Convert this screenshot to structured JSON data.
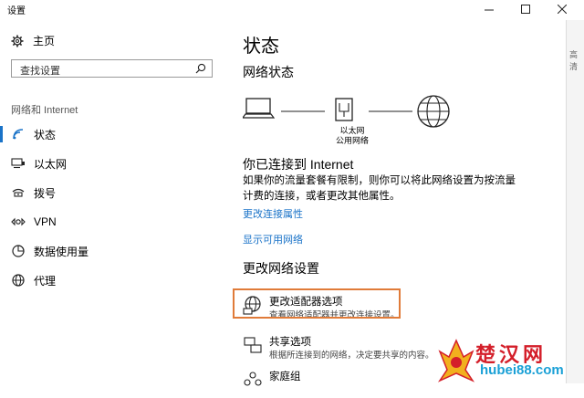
{
  "window": {
    "title": "设置"
  },
  "sidebar": {
    "home_label": "主页",
    "search_placeholder": "查找设置",
    "section_title": "网络和 Internet",
    "items": [
      {
        "label": "状态",
        "icon": "status-icon",
        "active": true
      },
      {
        "label": "以太网",
        "icon": "ethernet-icon",
        "active": false
      },
      {
        "label": "拨号",
        "icon": "dialup-icon",
        "active": false
      },
      {
        "label": "VPN",
        "icon": "vpn-icon",
        "active": false
      },
      {
        "label": "数据使用量",
        "icon": "data-usage-icon",
        "active": false
      },
      {
        "label": "代理",
        "icon": "proxy-icon",
        "active": false
      }
    ]
  },
  "main": {
    "title": "状态",
    "network_status_heading": "网络状态",
    "adapter_caption_1": "以太网",
    "adapter_caption_2": "公用网络",
    "connected_heading": "你已连接到 Internet",
    "connected_desc": "如果你的流量套餐有限制，则你可以将此网络设置为按流量计费的连接，或者更改其他属性。",
    "link_change_props": "更改连接属性",
    "link_show_networks": "显示可用网络",
    "change_settings_heading": "更改网络设置",
    "options": [
      {
        "title": "更改适配器选项",
        "subtitle": "查看网络适配器并更改连接设置。",
        "icon": "adapter-icon"
      },
      {
        "title": "共享选项",
        "subtitle": "根据所连接到的网络，决定要共享的内容。",
        "icon": "sharing-icon"
      },
      {
        "title": "家庭组",
        "subtitle": "",
        "icon": "homegroup-icon"
      }
    ]
  },
  "edge_text": "高清",
  "watermark": {
    "brand": "楚汉网",
    "url": "hubei88.com"
  },
  "colors": {
    "accent": "#1a73c8",
    "highlight": "#e07b39",
    "watermark_red": "#d41f2a",
    "watermark_blue": "#1aa0d6"
  }
}
